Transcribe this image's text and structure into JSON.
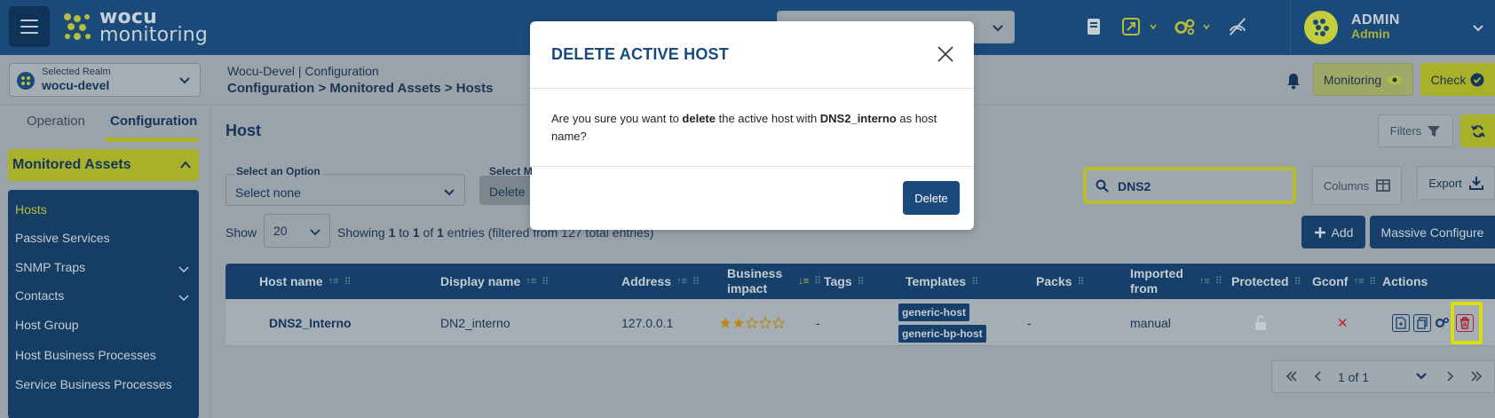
{
  "header": {
    "logo_line1": "wocu",
    "logo_line2": "monitoring",
    "user_name": "ADMIN",
    "user_role": "Admin"
  },
  "realm": {
    "label": "Selected Realm",
    "value": "wocu-devel"
  },
  "breadcrumb": {
    "top": "Wocu-Devel | Configuration",
    "main": "Configuration > Monitored Assets > Hosts"
  },
  "top_buttons": {
    "monitoring": "Monitoring",
    "check": "Check"
  },
  "sidebar": {
    "tab_operation": "Operation",
    "tab_configuration": "Configuration",
    "section": "Monitored Assets",
    "items": [
      {
        "label": "Hosts"
      },
      {
        "label": "Passive Services"
      },
      {
        "label": "SNMP Traps"
      },
      {
        "label": "Contacts"
      },
      {
        "label": "Host Group"
      },
      {
        "label": "Host Business Processes"
      },
      {
        "label": "Service Business Processes"
      }
    ]
  },
  "main": {
    "title": "Host",
    "filters_label": "Filters",
    "option_label": "Select an Option",
    "option_value": "Select none",
    "massive_label": "Select M",
    "massive_value": "Delete",
    "search_value": "DNS2",
    "columns_label": "Columns",
    "export_label": "Export",
    "show_label": "Show",
    "show_value": "20",
    "entries_prefix": "Showing ",
    "entries_from": "1",
    "entries_to_word": " to ",
    "entries_to": "1",
    "entries_of_word": " of ",
    "entries_total": "1",
    "entries_suffix": " entries (filtered from 127 total entries)",
    "add_label": "Add",
    "massive_configure_label": "Massive Configure"
  },
  "table": {
    "headers": {
      "host_name": "Host name",
      "display_name": "Display name",
      "address": "Address",
      "business_impact_1": "Business",
      "business_impact_2": "impact",
      "tags": "Tags",
      "templates": "Templates",
      "packs": "Packs",
      "imported_1": "Imported",
      "imported_2": "from",
      "protected": "Protected",
      "gconf": "Gconf",
      "actions": "Actions"
    },
    "rows": [
      {
        "host_name": "DNS2_Interno",
        "display_name": "DN2_interno",
        "address": "127.0.0.1",
        "business_impact": 2,
        "business_impact_max": 5,
        "tags": "-",
        "templates": [
          "generic-host",
          "generic-bp-host"
        ],
        "packs": "-",
        "imported_from": "manual",
        "gconf_symbol": "✕"
      }
    ]
  },
  "pager": {
    "text": "1 of 1"
  },
  "modal": {
    "title": "DELETE ACTIVE HOST",
    "body_prefix": "Are you sure you want to ",
    "body_action": "delete",
    "body_middle": " the active host with ",
    "body_host": "DNS2_interno",
    "body_suffix": " as host name?",
    "delete_label": "Delete"
  },
  "colors": {
    "primary": "#1a4a7a",
    "accent": "#a9b02a",
    "overlay": "#9aa2aa",
    "danger": "#b0202e"
  }
}
